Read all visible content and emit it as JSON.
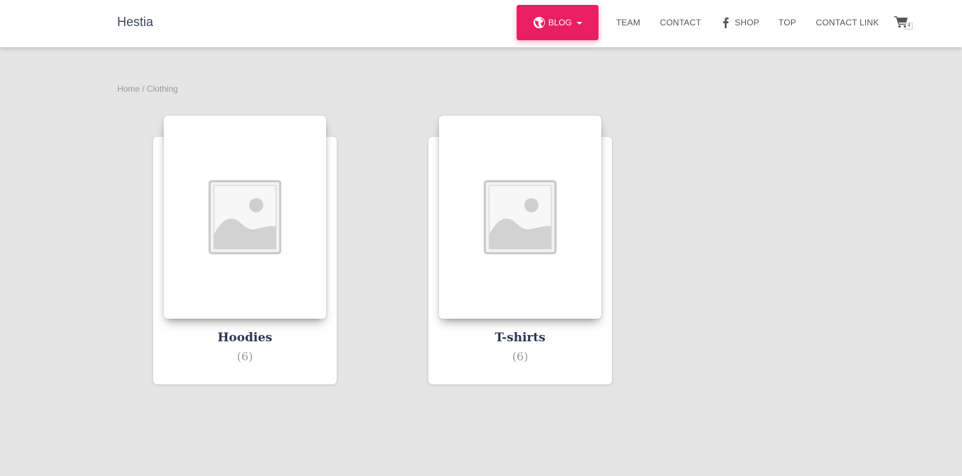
{
  "header": {
    "brand": "Hestia",
    "nav": {
      "blog": "BLOG",
      "team": "TEAM",
      "contact": "CONTACT",
      "shop": "SHOP",
      "top": "TOP",
      "contact_link": "CONTACT LINK"
    },
    "cart_count": "4",
    "icons": {
      "blog": "globe-icon",
      "shop": "facebook-icon",
      "cart": "shopping-cart-icon"
    },
    "accent_color": "#e91e63"
  },
  "breadcrumb": {
    "home": "Home",
    "separator": " / ",
    "current": "Clothing"
  },
  "categories": [
    {
      "name": "Hoodies",
      "count": "(6)",
      "image": "placeholder-image-icon"
    },
    {
      "name": "T-shirts",
      "count": "(6)",
      "image": "placeholder-image-icon"
    }
  ]
}
